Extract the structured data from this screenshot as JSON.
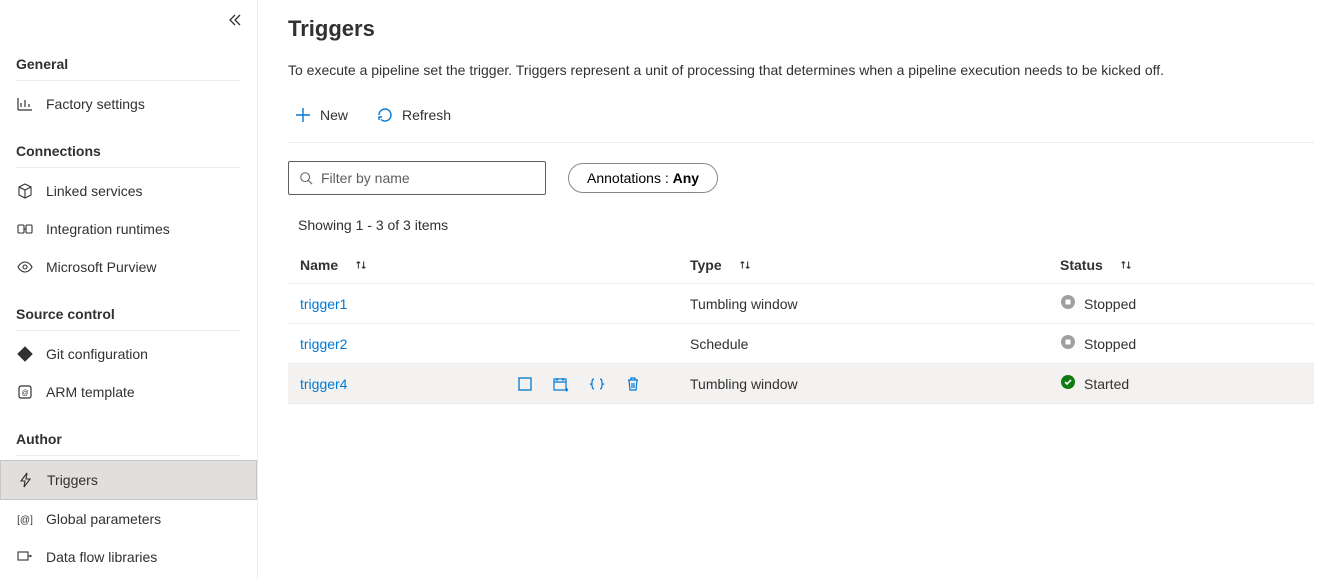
{
  "sidebar": {
    "sections": [
      {
        "header": "General",
        "items": [
          {
            "label": "Factory settings",
            "icon": "chart"
          }
        ]
      },
      {
        "header": "Connections",
        "items": [
          {
            "label": "Linked services",
            "icon": "cube"
          },
          {
            "label": "Integration runtimes",
            "icon": "runtime"
          },
          {
            "label": "Microsoft Purview",
            "icon": "eye"
          }
        ]
      },
      {
        "header": "Source control",
        "items": [
          {
            "label": "Git configuration",
            "icon": "git"
          },
          {
            "label": "ARM template",
            "icon": "arm"
          }
        ]
      },
      {
        "header": "Author",
        "items": [
          {
            "label": "Triggers",
            "icon": "bolt",
            "active": true
          },
          {
            "label": "Global parameters",
            "icon": "param"
          },
          {
            "label": "Data flow libraries",
            "icon": "dataflow"
          }
        ]
      }
    ]
  },
  "page": {
    "title": "Triggers",
    "description": "To execute a pipeline set the trigger. Triggers represent a unit of processing that determines when a pipeline execution needs to be kicked off."
  },
  "toolbar": {
    "new": "New",
    "refresh": "Refresh"
  },
  "filter": {
    "placeholder": "Filter by name",
    "annotations_label": "Annotations : ",
    "annotations_value": "Any"
  },
  "showing": "Showing 1 - 3 of 3 items",
  "columns": {
    "name": "Name",
    "type": "Type",
    "status": "Status"
  },
  "rows": [
    {
      "name": "trigger1",
      "type": "Tumbling window",
      "status": "Stopped",
      "status_kind": "stopped"
    },
    {
      "name": "trigger2",
      "type": "Schedule",
      "status": "Stopped",
      "status_kind": "stopped"
    },
    {
      "name": "trigger4",
      "type": "Tumbling window",
      "status": "Started",
      "status_kind": "started",
      "hovered": true
    }
  ]
}
